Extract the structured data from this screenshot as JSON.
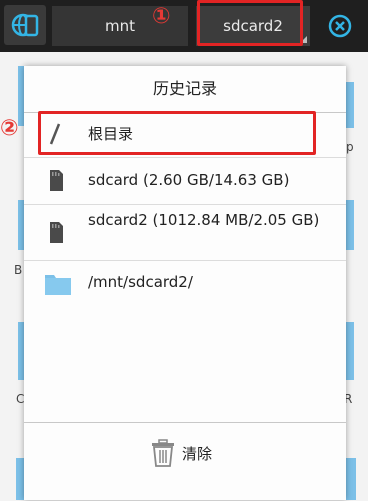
{
  "toolbar": {
    "breadcrumbs": [
      {
        "label": "mnt"
      },
      {
        "label": "sdcard2"
      }
    ]
  },
  "annotations": {
    "step1": "①",
    "step2": "②"
  },
  "background_letters": [
    "B",
    "p",
    "C",
    "R"
  ],
  "dialog": {
    "title": "历史记录",
    "items": [
      {
        "icon": "root-slash-icon",
        "label": "根目录"
      },
      {
        "icon": "sd-card-icon",
        "label": "sdcard (2.60 GB/14.63 GB)"
      },
      {
        "icon": "sd-card-icon",
        "label": "sdcard2 (1012.84 MB/2.05 GB)"
      },
      {
        "icon": "folder-icon",
        "label": "/mnt/sdcard2/"
      }
    ],
    "clear_label": "清除"
  },
  "colors": {
    "toolbar_bg": "#1f1f1f",
    "accent": "#33b5e5",
    "folder": "#7cc0e8",
    "highlight": "#e22424"
  }
}
